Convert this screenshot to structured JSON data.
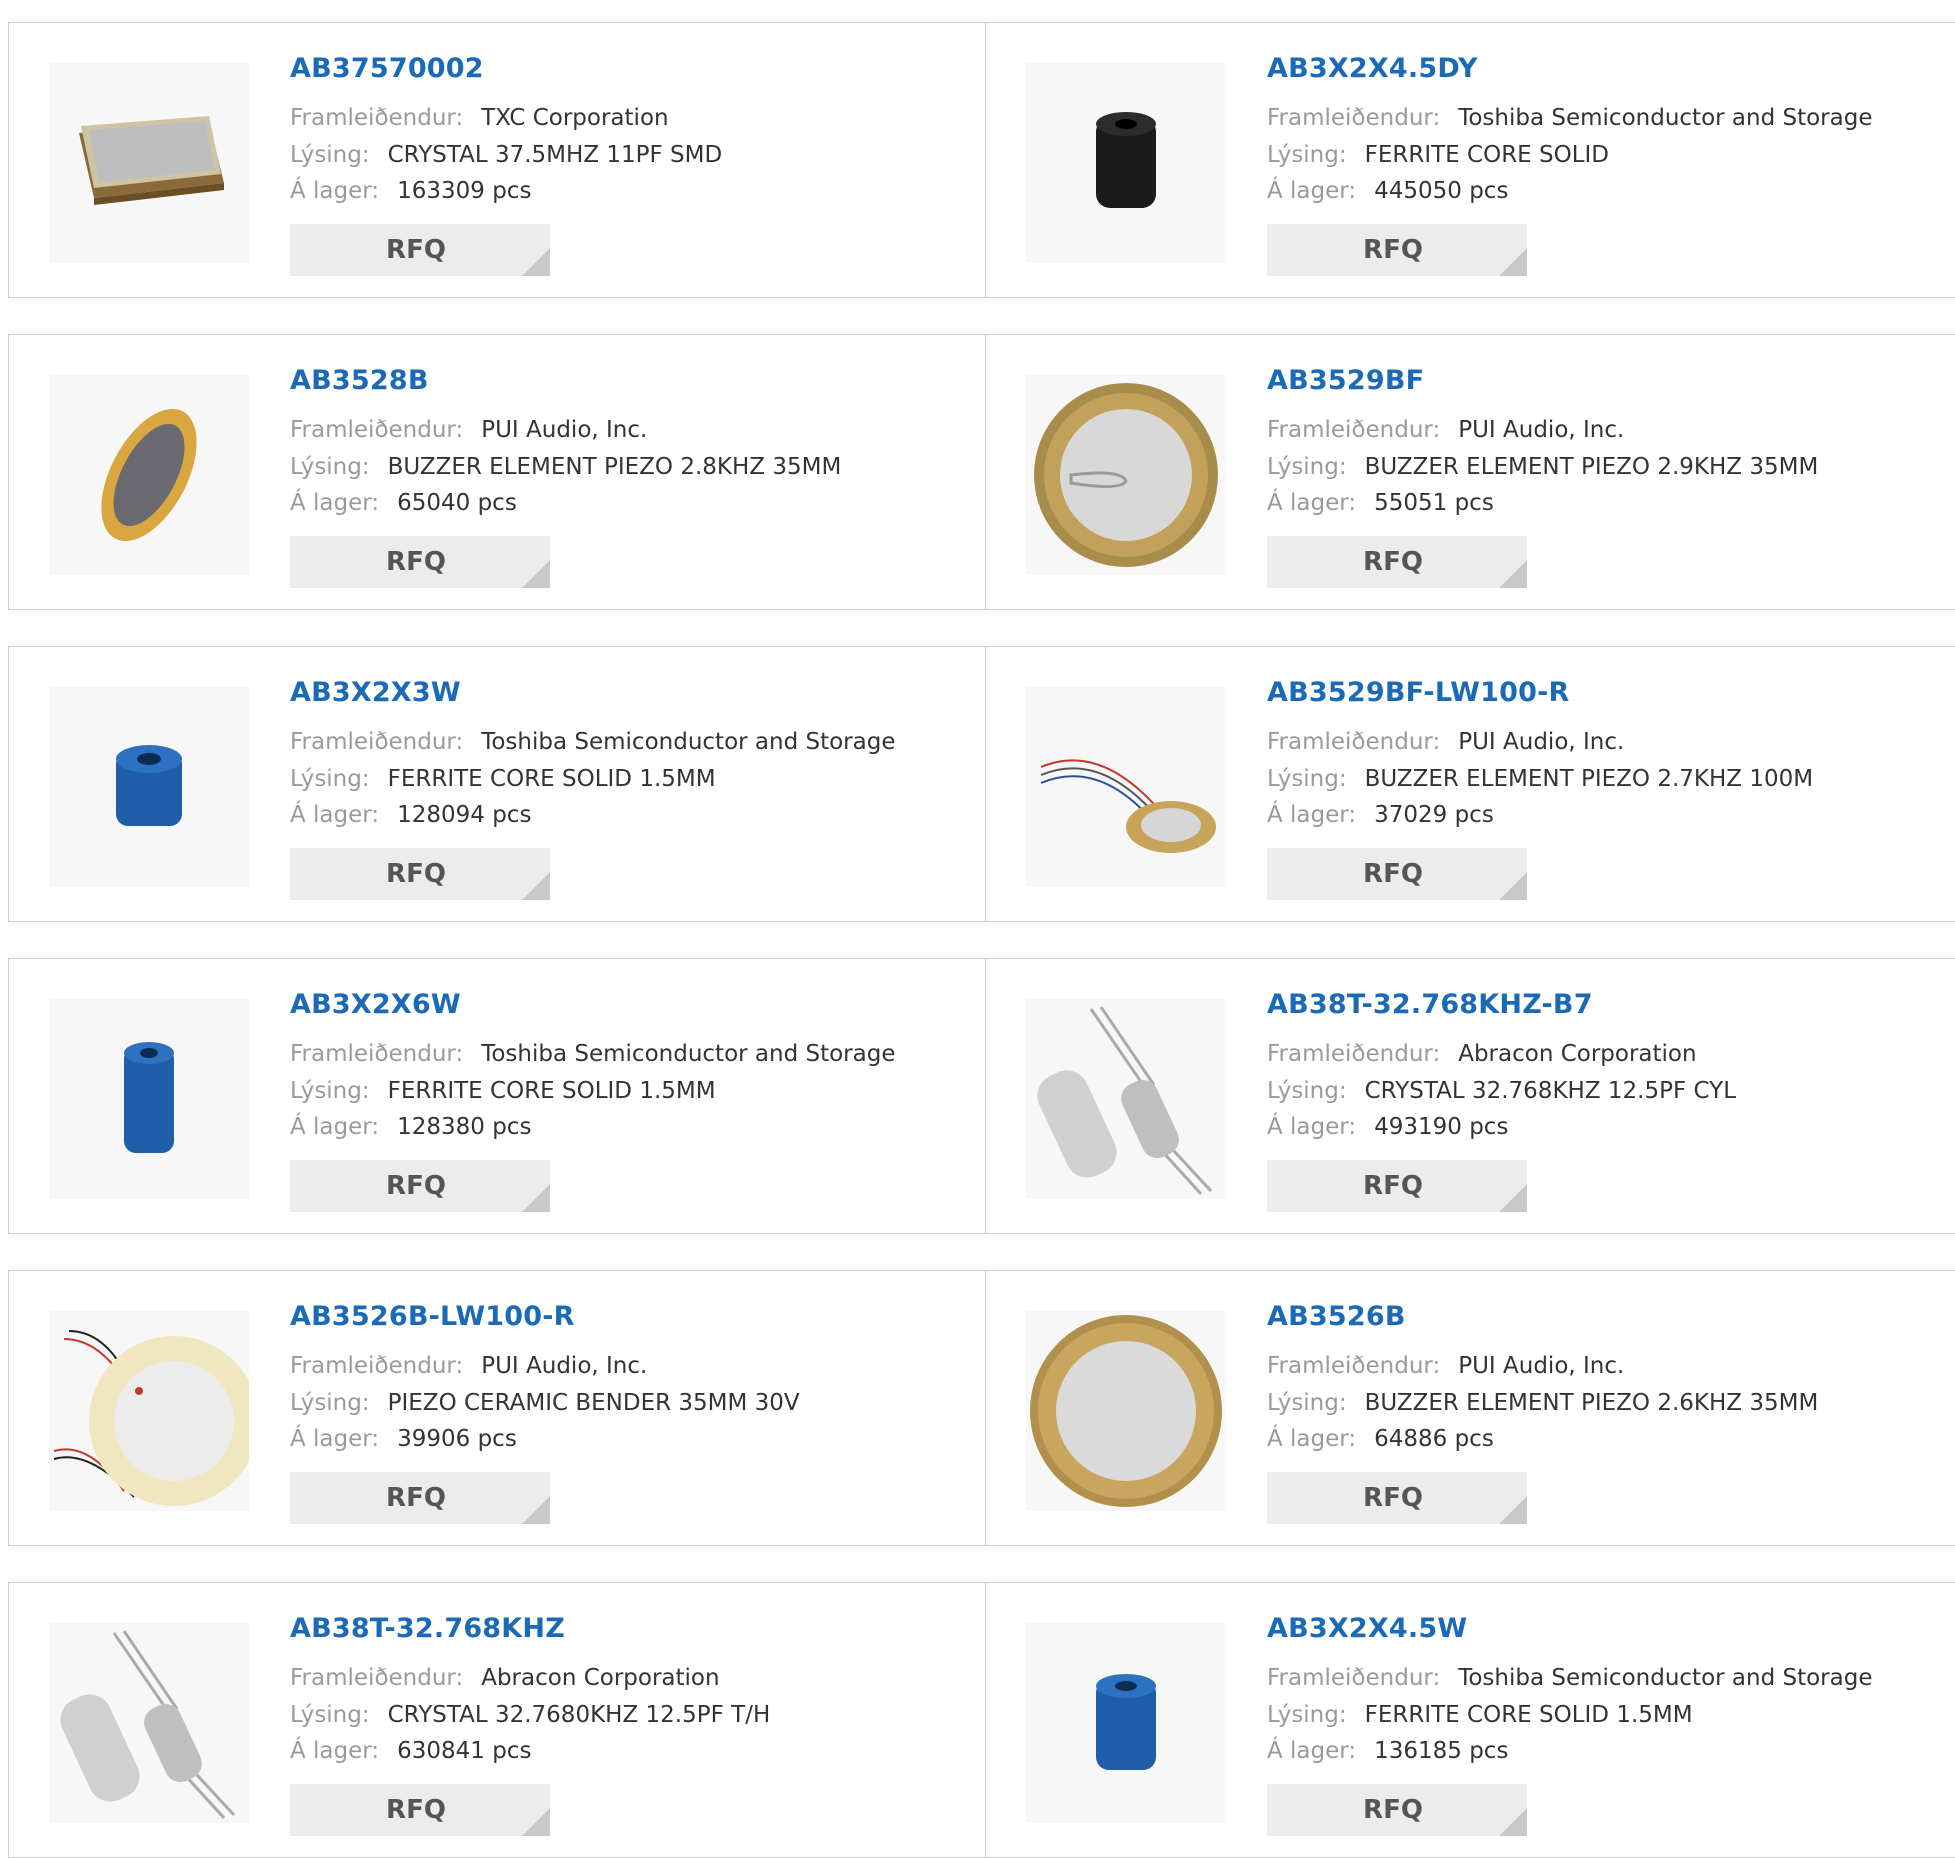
{
  "labels": {
    "manufacturer": "Framleiðendur:",
    "description": "Lýsing:",
    "stock": "Á lager:",
    "rfq": "RFQ"
  },
  "colors": {
    "part_number": "#1a6ab8",
    "label_gray": "#9a9a9a",
    "value_text": "#333333",
    "rfq_bg": "#ececec",
    "border": "#cfcfcf"
  },
  "products": [
    {
      "part": "AB37570002",
      "manufacturer": "TXC Corporation",
      "description": "CRYSTAL 37.5MHZ 11PF SMD",
      "stock": "163309 pcs",
      "image": "smd-crystal"
    },
    {
      "part": "AB3X2X4.5DY",
      "manufacturer": "Toshiba Semiconductor and Storage",
      "description": "FERRITE CORE SOLID",
      "stock": "445050 pcs",
      "image": "ferrite-black"
    },
    {
      "part": "AB3528B",
      "manufacturer": "PUI Audio, Inc.",
      "description": "BUZZER ELEMENT PIEZO 2.8KHZ 35MM",
      "stock": "65040 pcs",
      "image": "piezo-tilted"
    },
    {
      "part": "AB3529BF",
      "manufacturer": "PUI Audio, Inc.",
      "description": "BUZZER ELEMENT PIEZO 2.9KHZ 35MM",
      "stock": "55051 pcs",
      "image": "piezo-disc"
    },
    {
      "part": "AB3X2X3W",
      "manufacturer": "Toshiba Semiconductor and Storage",
      "description": "FERRITE CORE SOLID 1.5MM",
      "stock": "128094 pcs",
      "image": "ferrite-blue-short"
    },
    {
      "part": "AB3529BF-LW100-R",
      "manufacturer": "PUI Audio, Inc.",
      "description": "BUZZER ELEMENT PIEZO 2.7KHZ 100M",
      "stock": "37029 pcs",
      "image": "piezo-wired-small"
    },
    {
      "part": "AB3X2X6W",
      "manufacturer": "Toshiba Semiconductor and Storage",
      "description": "FERRITE CORE SOLID 1.5MM",
      "stock": "128380 pcs",
      "image": "ferrite-blue-tall"
    },
    {
      "part": "AB38T-32.768KHZ-B7",
      "manufacturer": "Abracon Corporation",
      "description": "CRYSTAL 32.768KHZ 12.5PF CYL",
      "stock": "493190 pcs",
      "image": "cyl-crystal"
    },
    {
      "part": "AB3526B-LW100-R",
      "manufacturer": "PUI Audio, Inc.",
      "description": "PIEZO CERAMIC BENDER 35MM 30V",
      "stock": "39906 pcs",
      "image": "piezo-wired-large"
    },
    {
      "part": "AB3526B",
      "manufacturer": "PUI Audio, Inc.",
      "description": "BUZZER ELEMENT PIEZO 2.6KHZ 35MM",
      "stock": "64886 pcs",
      "image": "piezo-disc-plain"
    },
    {
      "part": "AB38T-32.768KHZ",
      "manufacturer": "Abracon Corporation",
      "description": "CRYSTAL 32.7680KHZ 12.5PF T/H",
      "stock": "630841 pcs",
      "image": "cyl-crystal"
    },
    {
      "part": "AB3X2X4.5W",
      "manufacturer": "Toshiba Semiconductor and Storage",
      "description": "FERRITE CORE SOLID 1.5MM",
      "stock": "136185 pcs",
      "image": "ferrite-blue-mid"
    }
  ]
}
